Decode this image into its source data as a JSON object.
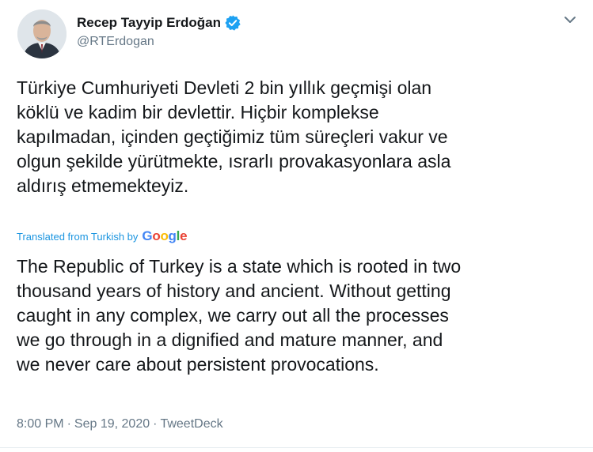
{
  "author": {
    "display_name": "Recep Tayyip Erdoğan",
    "handle": "@RTErdogan",
    "verified": true,
    "verified_color": "#1da1f2",
    "avatar_icon": "profile-photo"
  },
  "tweet": {
    "original_lines": [
      "Türkiye Cumhuriyeti Devleti 2 bin yıllık geçmişi olan",
      "köklü ve kadim bir devlettir. Hiçbir komplekse",
      "kapılmadan, içinden geçtiğimiz tüm süreçleri vakur ve",
      "olgun şekilde yürütmekte, ısrarlı provakasyonlara asla",
      "aldırış etmemekteyiz."
    ],
    "translated_from": "Translated from Turkish by",
    "translator_brand": "Google",
    "translation_lines": [
      "The Republic of Turkey is a state which is rooted in two",
      "thousand years of history and ancient. Without getting",
      "caught in any complex, we carry out all the processes",
      "we go through in a dignified and mature manner, and",
      "we never care about persistent provocations."
    ]
  },
  "meta": {
    "time": "8:00 PM",
    "date": "Sep 19, 2020",
    "source": "TweetDeck",
    "separator": "·"
  },
  "colors": {
    "link": "#1b95e0",
    "secondary": "#657786",
    "primary_text": "#14171a"
  }
}
